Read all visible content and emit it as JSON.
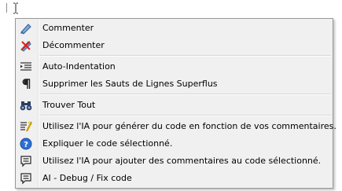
{
  "menu": {
    "items": [
      {
        "label": "Commenter",
        "icon": "comment-icon"
      },
      {
        "label": "Décommenter",
        "icon": "uncomment-icon"
      },
      {
        "label": "Auto-Indentation",
        "icon": "indent-icon"
      },
      {
        "label": "Supprimer les Sauts de Lignes Superflus",
        "icon": "pilcrow-icon"
      },
      {
        "label": "Trouver Tout",
        "icon": "binoculars-icon"
      },
      {
        "label": "Utilisez l'IA pour générer du code en fonction de vos commentaires.",
        "icon": "ai-generate-icon"
      },
      {
        "label": "Expliquer le code sélectionné.",
        "icon": "help-icon"
      },
      {
        "label": "Utilisez l'IA pour ajouter des commentaires au code sélectionné.",
        "icon": "ai-comment-icon"
      },
      {
        "label": "AI - Debug / Fix code",
        "icon": "ai-debug-icon"
      }
    ]
  }
}
